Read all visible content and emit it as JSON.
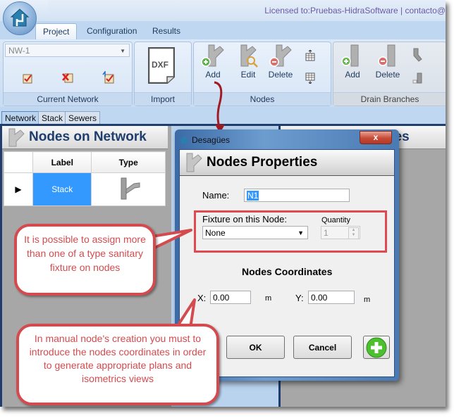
{
  "app": {
    "license_text": "Licensed to:Pruebas-HidraSoftware | contacto@",
    "ribbon_tabs": [
      {
        "label": "Project",
        "active": true
      },
      {
        "label": "Configuration",
        "active": false
      },
      {
        "label": "Results",
        "active": false
      }
    ]
  },
  "ribbon": {
    "current_network": {
      "group_label": "Current Network",
      "network_value": "NW-1",
      "buttons": [
        "new-network-icon",
        "delete-network-icon",
        "rename-network-icon"
      ]
    },
    "import": {
      "group_label": "Import",
      "button_icon_text": "DXF"
    },
    "nodes": {
      "group_label": "Nodes",
      "add_label": "Add",
      "edit_label": "Edit",
      "delete_label": "Delete"
    },
    "drain_branches": {
      "group_label": "Drain Branches",
      "add_label": "Add",
      "delete_label": "Delete"
    }
  },
  "doc_tabs": [
    {
      "label": "Network",
      "active": true
    },
    {
      "label": "Stack",
      "active": false
    },
    {
      "label": "Sewers",
      "active": false
    }
  ],
  "left_panel": {
    "title": "Nodes on Network",
    "columns": [
      "Label",
      "Type"
    ],
    "rows": [
      {
        "label": "Stack",
        "type_icon": "stack-node-icon",
        "selected": true
      }
    ]
  },
  "right_panel": {
    "title_fragment": "nes"
  },
  "dialog": {
    "window_title": "Desagües",
    "close_label": "x",
    "header_title": "Nodes Properties",
    "name_label": "Name:",
    "name_value": "N1",
    "fixture_label": "Fixture on this Node:",
    "fixture_value": "None",
    "quantity_label": "Quantity",
    "quantity_value": "1",
    "coordinates_title": "Nodes Coordinates",
    "x_label": "X:",
    "x_value": "0.00",
    "x_unit": "m",
    "y_label": "Y:",
    "y_value": "0.00",
    "y_unit": "m",
    "ok_label": "OK",
    "cancel_label": "Cancel"
  },
  "callouts": {
    "fixture_note": "It is possible to assign more than one of a type sanitary fixture on nodes",
    "coordinates_note": "In manual node's creation you must to introduce the nodes coordinates in order to generate appropriate plans and isometrics views"
  },
  "colors": {
    "callout_red": "#d34b4f",
    "selection_blue": "#3399ff",
    "panel_title_blue": "#1f3e6e",
    "arrow_red": "#a01c24"
  }
}
